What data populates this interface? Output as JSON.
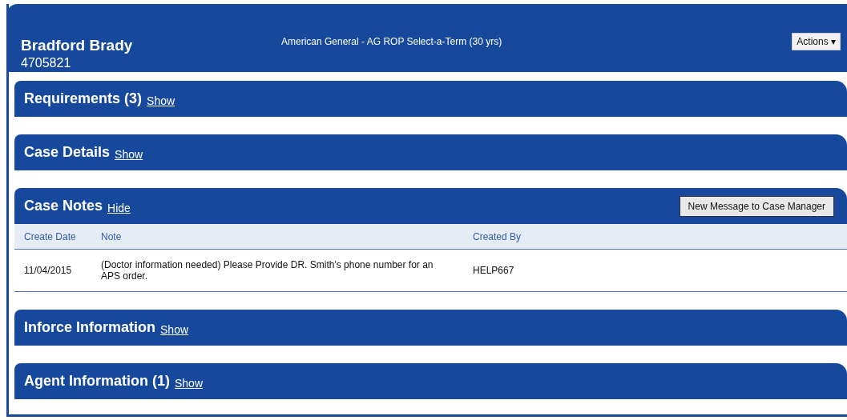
{
  "header": {
    "name": "Bradford Brady",
    "case_number": "4705821",
    "product": "American General - AG ROP Select-a-Term (30 yrs)",
    "actions_button": "Actions ▾"
  },
  "sections": [
    {
      "title": "Requirements (3)",
      "toggle": "Show"
    },
    {
      "title": "Case Details",
      "toggle": "Show"
    },
    {
      "title": "Case Notes",
      "toggle": "Hide",
      "action_button": "New Message to Case Manager",
      "table": {
        "columns": [
          "Create Date",
          "Note",
          "Created By"
        ],
        "rows": [
          {
            "create_date": "11/04/2015",
            "note": "(Doctor information needed) Please Provide DR. Smith's phone number for an APS order.",
            "created_by": "HELP667"
          }
        ]
      }
    },
    {
      "title": "Inforce Information",
      "toggle": "Show"
    },
    {
      "title": "Agent Information (1)",
      "toggle": "Show"
    }
  ]
}
